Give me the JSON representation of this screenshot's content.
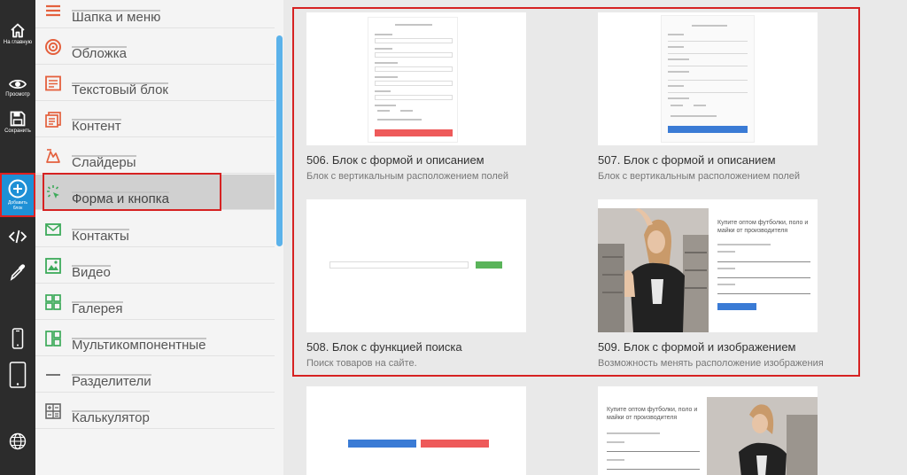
{
  "toolbar": {
    "home_label": "На главную",
    "preview_label": "Просмотр",
    "save_label": "Сохранить",
    "add_block_label": "Добавить блок"
  },
  "sidebar": {
    "items": [
      {
        "label": "Шапка и меню",
        "icon": "menu-icon"
      },
      {
        "label": "Обложка",
        "icon": "cover-icon"
      },
      {
        "label": "Текстовый блок",
        "icon": "text-block-icon"
      },
      {
        "label": "Контент",
        "icon": "content-icon"
      },
      {
        "label": "Слайдеры",
        "icon": "slider-icon"
      },
      {
        "label": "Форма и кнопка",
        "icon": "form-button-icon"
      },
      {
        "label": "Контакты",
        "icon": "contacts-icon"
      },
      {
        "label": "Видео",
        "icon": "video-icon"
      },
      {
        "label": "Галерея",
        "icon": "gallery-icon"
      },
      {
        "label": "Мультикомпонентные",
        "icon": "multicomponent-icon"
      },
      {
        "label": "Разделители",
        "icon": "divider-icon"
      },
      {
        "label": "Калькулятор",
        "icon": "calculator-icon"
      }
    ],
    "active_index": 5
  },
  "cards": [
    {
      "title": "506. Блок с формой и описанием",
      "desc": "Блок с вертикальным расположением полей"
    },
    {
      "title": "507. Блок с формой и описанием",
      "desc": "Блок с вертикальным расположением полей"
    },
    {
      "title": "508. Блок с функцией поиска",
      "desc": "Поиск товаров на сайте."
    },
    {
      "title": "509. Блок с формой и изображением",
      "desc": "Возможность менять расположение изображения"
    }
  ],
  "preview_509": {
    "heading": "Купите оптом футболки, поло и майки от производителя"
  },
  "preview_bottom_right": {
    "heading": "Купите оптом футболки, поло и майки от производителя"
  },
  "colors": {
    "accent_red": "#d62222",
    "add_button_blue": "#1e90d6",
    "form_button_red": "#ee5a5a",
    "form_button_blue": "#3a7bd5",
    "search_button_green": "#5ab45a"
  }
}
